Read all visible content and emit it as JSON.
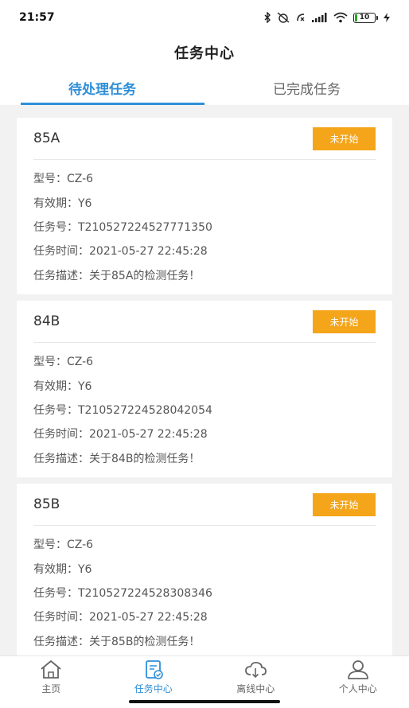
{
  "status_bar": {
    "time": "21:57",
    "battery_level": "10",
    "icons": [
      "bluetooth-icon",
      "alarm-off-icon",
      "nfc-icon",
      "signal-icon",
      "wifi-icon",
      "battery-icon",
      "charging-icon"
    ]
  },
  "header": {
    "title": "任务中心"
  },
  "tabs": [
    {
      "label": "待处理任务",
      "active": true
    },
    {
      "label": "已完成任务",
      "active": false
    }
  ],
  "tasks": [
    {
      "name": "85A",
      "status": "未开始",
      "model": "型号：CZ-6",
      "validity": "有效期：Y6",
      "task_no": "任务号：T210527224527771350",
      "task_time": "任务时间：2021-05-27 22:45:28",
      "description": "任务描述：关于85A的检测任务！"
    },
    {
      "name": "84B",
      "status": "未开始",
      "model": "型号：CZ-6",
      "validity": "有效期：Y6",
      "task_no": "任务号：T210527224528042054",
      "task_time": "任务时间：2021-05-27 22:45:28",
      "description": "任务描述：关于84B的检测任务！"
    },
    {
      "name": "85B",
      "status": "未开始",
      "model": "型号：CZ-6",
      "validity": "有效期：Y6",
      "task_no": "任务号：T210527224528308346",
      "task_time": "任务时间：2021-05-27 22:45:28",
      "description": "任务描述：关于85B的检测任务！"
    }
  ],
  "bottom_nav": [
    {
      "label": "主页",
      "icon": "home-icon",
      "active": false
    },
    {
      "label": "任务中心",
      "icon": "task-icon",
      "active": true
    },
    {
      "label": "离线中心",
      "icon": "cloud-download-icon",
      "active": false
    },
    {
      "label": "个人中心",
      "icon": "user-icon",
      "active": false
    }
  ],
  "colors": {
    "accent": "#2f8fd8",
    "status_badge": "#f4a51a",
    "background": "#f2f2f2"
  }
}
